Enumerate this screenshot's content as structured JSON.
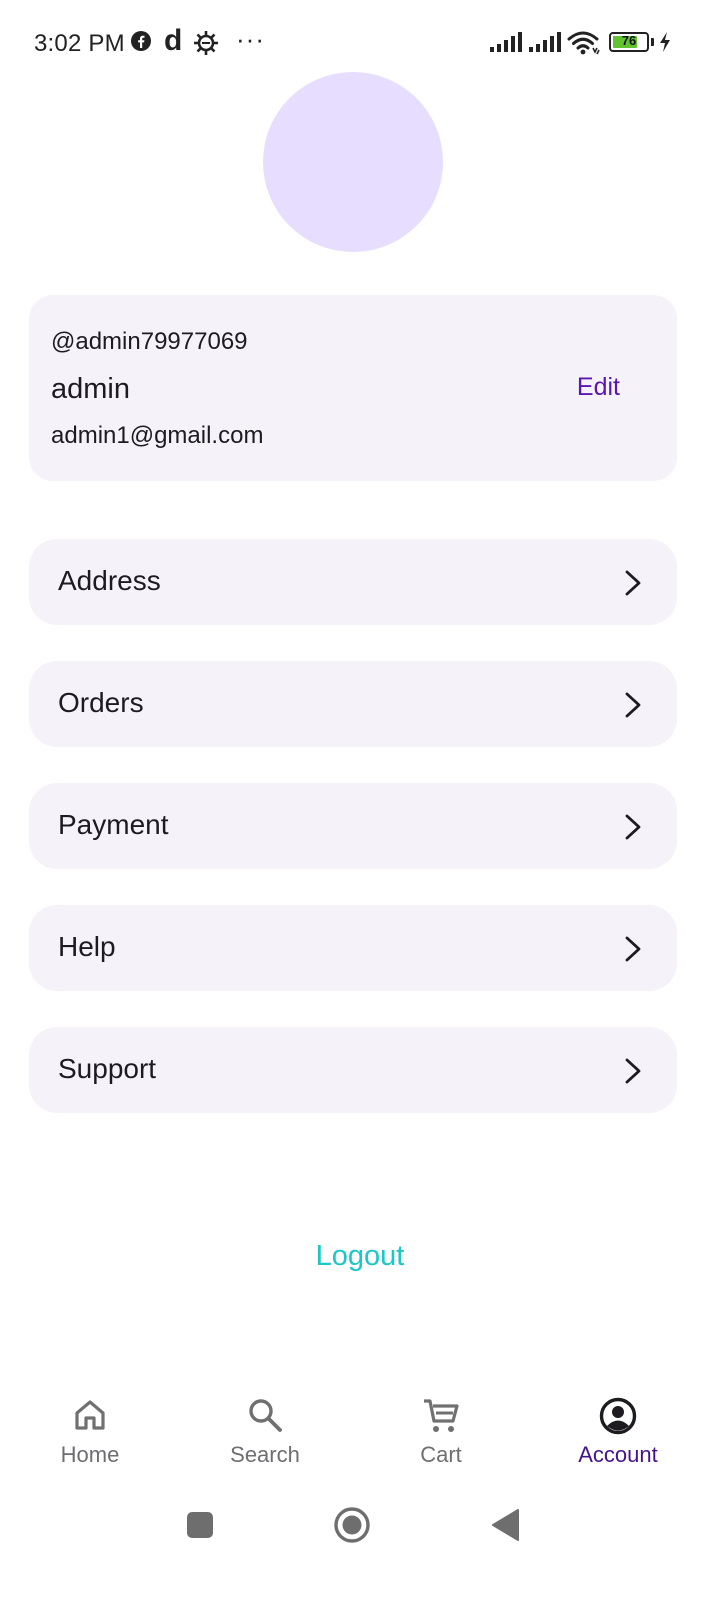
{
  "status_bar": {
    "time": "3:02 PM",
    "d_letter": "d",
    "more": "···",
    "battery_level": 76,
    "battery_text": "76",
    "battery_color": "#61c232",
    "icons": [
      "facebook-icon",
      "d-app-icon",
      "gear-icon",
      "more-dots-icon",
      "signal-icon",
      "signal-icon",
      "wifi-icon",
      "battery-icon",
      "charging-bolt-icon"
    ]
  },
  "profile": {
    "avatar_color": "#e7deff",
    "username": "@admin79977069",
    "name": "admin",
    "email": "admin1@gmail.com",
    "edit_label": "Edit"
  },
  "menu": {
    "items": [
      {
        "label": "Address"
      },
      {
        "label": "Orders"
      },
      {
        "label": "Payment"
      },
      {
        "label": "Help"
      },
      {
        "label": "Support"
      }
    ],
    "chevron_icon": "chevron-right-icon"
  },
  "logout_label": "Logout",
  "bottom_nav": {
    "items": [
      {
        "label": "Home",
        "icon": "home-icon"
      },
      {
        "label": "Search",
        "icon": "search-icon"
      },
      {
        "label": "Cart",
        "icon": "cart-icon"
      },
      {
        "label": "Account",
        "icon": "account-icon"
      }
    ],
    "active": "Account"
  },
  "colors": {
    "accent": "#5a17b0",
    "nav_active": "#45148c",
    "logout": "#1cc7c7",
    "card_bg": "#f6f2fa"
  }
}
